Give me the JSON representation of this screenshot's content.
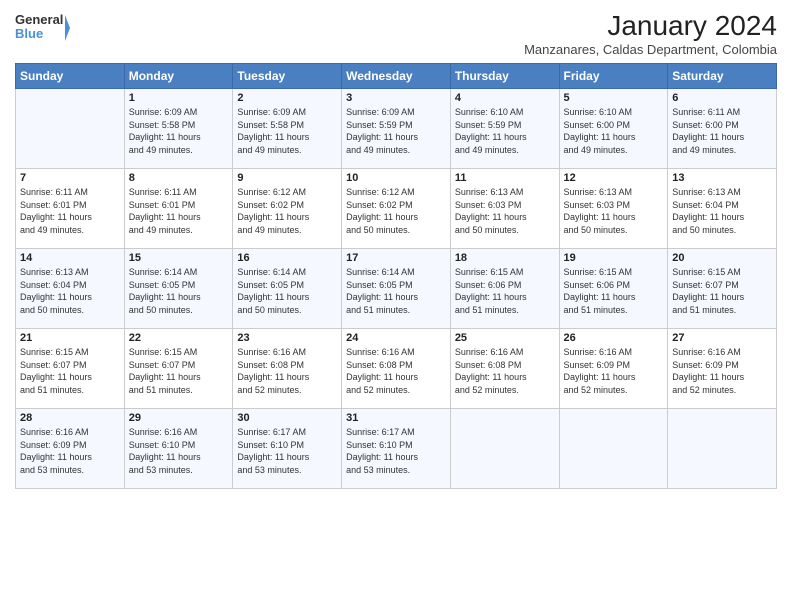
{
  "logo": {
    "line1": "General",
    "line2": "Blue"
  },
  "title": "January 2024",
  "subtitle": "Manzanares, Caldas Department, Colombia",
  "days_of_week": [
    "Sunday",
    "Monday",
    "Tuesday",
    "Wednesday",
    "Thursday",
    "Friday",
    "Saturday"
  ],
  "weeks": [
    [
      {
        "day": "",
        "info": ""
      },
      {
        "day": "1",
        "info": "Sunrise: 6:09 AM\nSunset: 5:58 PM\nDaylight: 11 hours\nand 49 minutes."
      },
      {
        "day": "2",
        "info": "Sunrise: 6:09 AM\nSunset: 5:58 PM\nDaylight: 11 hours\nand 49 minutes."
      },
      {
        "day": "3",
        "info": "Sunrise: 6:09 AM\nSunset: 5:59 PM\nDaylight: 11 hours\nand 49 minutes."
      },
      {
        "day": "4",
        "info": "Sunrise: 6:10 AM\nSunset: 5:59 PM\nDaylight: 11 hours\nand 49 minutes."
      },
      {
        "day": "5",
        "info": "Sunrise: 6:10 AM\nSunset: 6:00 PM\nDaylight: 11 hours\nand 49 minutes."
      },
      {
        "day": "6",
        "info": "Sunrise: 6:11 AM\nSunset: 6:00 PM\nDaylight: 11 hours\nand 49 minutes."
      }
    ],
    [
      {
        "day": "7",
        "info": "Sunrise: 6:11 AM\nSunset: 6:01 PM\nDaylight: 11 hours\nand 49 minutes."
      },
      {
        "day": "8",
        "info": "Sunrise: 6:11 AM\nSunset: 6:01 PM\nDaylight: 11 hours\nand 49 minutes."
      },
      {
        "day": "9",
        "info": "Sunrise: 6:12 AM\nSunset: 6:02 PM\nDaylight: 11 hours\nand 49 minutes."
      },
      {
        "day": "10",
        "info": "Sunrise: 6:12 AM\nSunset: 6:02 PM\nDaylight: 11 hours\nand 50 minutes."
      },
      {
        "day": "11",
        "info": "Sunrise: 6:13 AM\nSunset: 6:03 PM\nDaylight: 11 hours\nand 50 minutes."
      },
      {
        "day": "12",
        "info": "Sunrise: 6:13 AM\nSunset: 6:03 PM\nDaylight: 11 hours\nand 50 minutes."
      },
      {
        "day": "13",
        "info": "Sunrise: 6:13 AM\nSunset: 6:04 PM\nDaylight: 11 hours\nand 50 minutes."
      }
    ],
    [
      {
        "day": "14",
        "info": "Sunrise: 6:13 AM\nSunset: 6:04 PM\nDaylight: 11 hours\nand 50 minutes."
      },
      {
        "day": "15",
        "info": "Sunrise: 6:14 AM\nSunset: 6:05 PM\nDaylight: 11 hours\nand 50 minutes."
      },
      {
        "day": "16",
        "info": "Sunrise: 6:14 AM\nSunset: 6:05 PM\nDaylight: 11 hours\nand 50 minutes."
      },
      {
        "day": "17",
        "info": "Sunrise: 6:14 AM\nSunset: 6:05 PM\nDaylight: 11 hours\nand 51 minutes."
      },
      {
        "day": "18",
        "info": "Sunrise: 6:15 AM\nSunset: 6:06 PM\nDaylight: 11 hours\nand 51 minutes."
      },
      {
        "day": "19",
        "info": "Sunrise: 6:15 AM\nSunset: 6:06 PM\nDaylight: 11 hours\nand 51 minutes."
      },
      {
        "day": "20",
        "info": "Sunrise: 6:15 AM\nSunset: 6:07 PM\nDaylight: 11 hours\nand 51 minutes."
      }
    ],
    [
      {
        "day": "21",
        "info": "Sunrise: 6:15 AM\nSunset: 6:07 PM\nDaylight: 11 hours\nand 51 minutes."
      },
      {
        "day": "22",
        "info": "Sunrise: 6:15 AM\nSunset: 6:07 PM\nDaylight: 11 hours\nand 51 minutes."
      },
      {
        "day": "23",
        "info": "Sunrise: 6:16 AM\nSunset: 6:08 PM\nDaylight: 11 hours\nand 52 minutes."
      },
      {
        "day": "24",
        "info": "Sunrise: 6:16 AM\nSunset: 6:08 PM\nDaylight: 11 hours\nand 52 minutes."
      },
      {
        "day": "25",
        "info": "Sunrise: 6:16 AM\nSunset: 6:08 PM\nDaylight: 11 hours\nand 52 minutes."
      },
      {
        "day": "26",
        "info": "Sunrise: 6:16 AM\nSunset: 6:09 PM\nDaylight: 11 hours\nand 52 minutes."
      },
      {
        "day": "27",
        "info": "Sunrise: 6:16 AM\nSunset: 6:09 PM\nDaylight: 11 hours\nand 52 minutes."
      }
    ],
    [
      {
        "day": "28",
        "info": "Sunrise: 6:16 AM\nSunset: 6:09 PM\nDaylight: 11 hours\nand 53 minutes."
      },
      {
        "day": "29",
        "info": "Sunrise: 6:16 AM\nSunset: 6:10 PM\nDaylight: 11 hours\nand 53 minutes."
      },
      {
        "day": "30",
        "info": "Sunrise: 6:17 AM\nSunset: 6:10 PM\nDaylight: 11 hours\nand 53 minutes."
      },
      {
        "day": "31",
        "info": "Sunrise: 6:17 AM\nSunset: 6:10 PM\nDaylight: 11 hours\nand 53 minutes."
      },
      {
        "day": "",
        "info": ""
      },
      {
        "day": "",
        "info": ""
      },
      {
        "day": "",
        "info": ""
      }
    ]
  ]
}
